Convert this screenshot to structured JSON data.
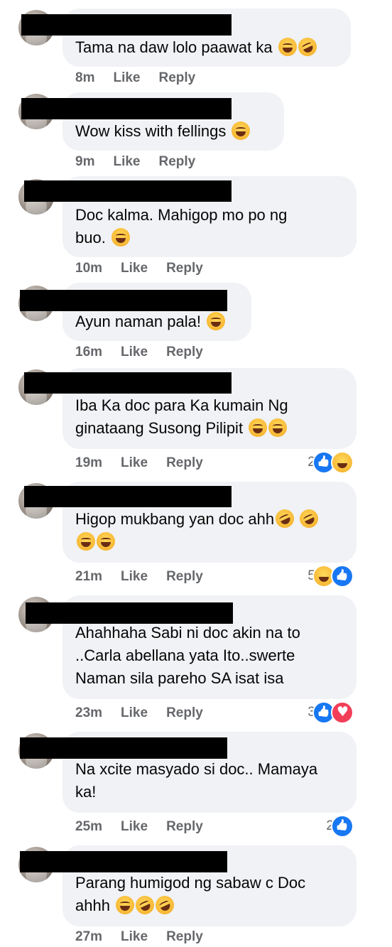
{
  "comments": [
    {
      "text": "Tama na daw lolo paawat ka",
      "emojis": [
        "grin-sweat-emoji",
        "rofl-emoji"
      ],
      "time": "8m",
      "like_label": "Like",
      "reply_label": "Reply",
      "reactions": null
    },
    {
      "text": "Wow kiss with fellings",
      "emojis": [
        "laugh-cry-emoji"
      ],
      "time": "9m",
      "like_label": "Like",
      "reply_label": "Reply",
      "reactions": null
    },
    {
      "text": "Doc kalma. Mahigop mo po ng\nbuo.",
      "emojis": [
        "laugh-cry-emoji"
      ],
      "time": "10m",
      "like_label": "Like",
      "reply_label": "Reply",
      "reactions": null
    },
    {
      "text": "Ayun naman pala!",
      "emojis": [
        "laugh-cry-emoji"
      ],
      "time": "16m",
      "like_label": "Like",
      "reply_label": "Reply",
      "reactions": null
    },
    {
      "text": "Iba Ka doc para Ka kumain Ng\nginataang Susong Pilipit",
      "emojis": [
        "laugh-cry-emoji",
        "laugh-cry-emoji"
      ],
      "time": "19m",
      "like_label": "Like",
      "reply_label": "Reply",
      "reactions": {
        "count": "2",
        "icons": [
          "like",
          "haha"
        ]
      }
    },
    {
      "text": "Higop mukbang yan doc ahh",
      "emojis": [
        "rofl-emoji",
        "rofl-emoji",
        "grin-emoji",
        "grin-emoji"
      ],
      "time": "21m",
      "like_label": "Like",
      "reply_label": "Reply",
      "reactions": {
        "count": "5",
        "icons": [
          "haha",
          "like"
        ]
      }
    },
    {
      "text": "Ahahhaha Sabi ni doc akin na to\n..Carla abellana yata Ito..swerte\nNaman sila pareho SA isat isa",
      "emojis": [],
      "time": "23m",
      "like_label": "Like",
      "reply_label": "Reply",
      "reactions": {
        "count": "3",
        "icons": [
          "like",
          "love"
        ]
      }
    },
    {
      "text": "Na xcite masyado si doc.. Mamaya\nka!",
      "emojis": [],
      "time": "25m",
      "like_label": "Like",
      "reply_label": "Reply",
      "reactions": {
        "count": "2",
        "icons": [
          "like"
        ]
      }
    },
    {
      "text": "Parang humigod ng sabaw c Doc\nahhh",
      "emojis": [
        "grin-sweat-emoji",
        "rofl-emoji",
        "rofl-emoji"
      ],
      "time": "27m",
      "like_label": "Like",
      "reply_label": "Reply",
      "reactions": null
    }
  ],
  "colors": {
    "bubble": "#f0f2f5",
    "meta_text": "#65676b",
    "like_blue": "#1877f2",
    "love_red": "#f33e58"
  }
}
